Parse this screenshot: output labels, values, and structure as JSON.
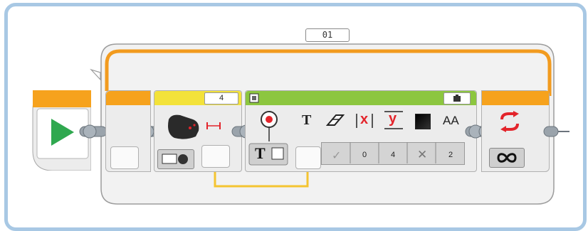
{
  "loop": {
    "name": "01",
    "mode_icon": "infinity-icon",
    "loop_icon": "loop-arrows-icon"
  },
  "start_block": {
    "icon": "play-icon"
  },
  "sensor_block": {
    "port": "4",
    "sensor_icon": "ultrasonic-sensor-icon",
    "measure_icon": "distance-arrows-icon",
    "mode_icon": "measure-centimeters-icon",
    "output_value": ""
  },
  "display_block": {
    "header_icon": "display-brick-icon",
    "brick_icon": "brick-icon",
    "mode_icon": "display-text-grid-icon",
    "mode_text_glyph": "T",
    "wired_input_icon": "text-input-icon",
    "params": [
      {
        "icon_name": "text-icon",
        "glyph": "T",
        "value": ""
      },
      {
        "icon_name": "clear-screen-icon",
        "glyph": "eraser",
        "value": "✓"
      },
      {
        "icon_name": "x-column-icon",
        "glyph": "x",
        "value": "0"
      },
      {
        "icon_name": "y-row-icon",
        "glyph": "y",
        "value": "4"
      },
      {
        "icon_name": "color-icon",
        "glyph": "square",
        "value": "✕"
      },
      {
        "icon_name": "font-icon",
        "glyph": "AA",
        "value": "2"
      }
    ]
  },
  "colors": {
    "flow_orange": "#f29b1f",
    "sensor_yellow": "#f3e23a",
    "display_green": "#8cc63f",
    "wire_yellow": "#f4c431",
    "frame_blue": "#a8c8e4",
    "red_icon": "#e3242b"
  }
}
